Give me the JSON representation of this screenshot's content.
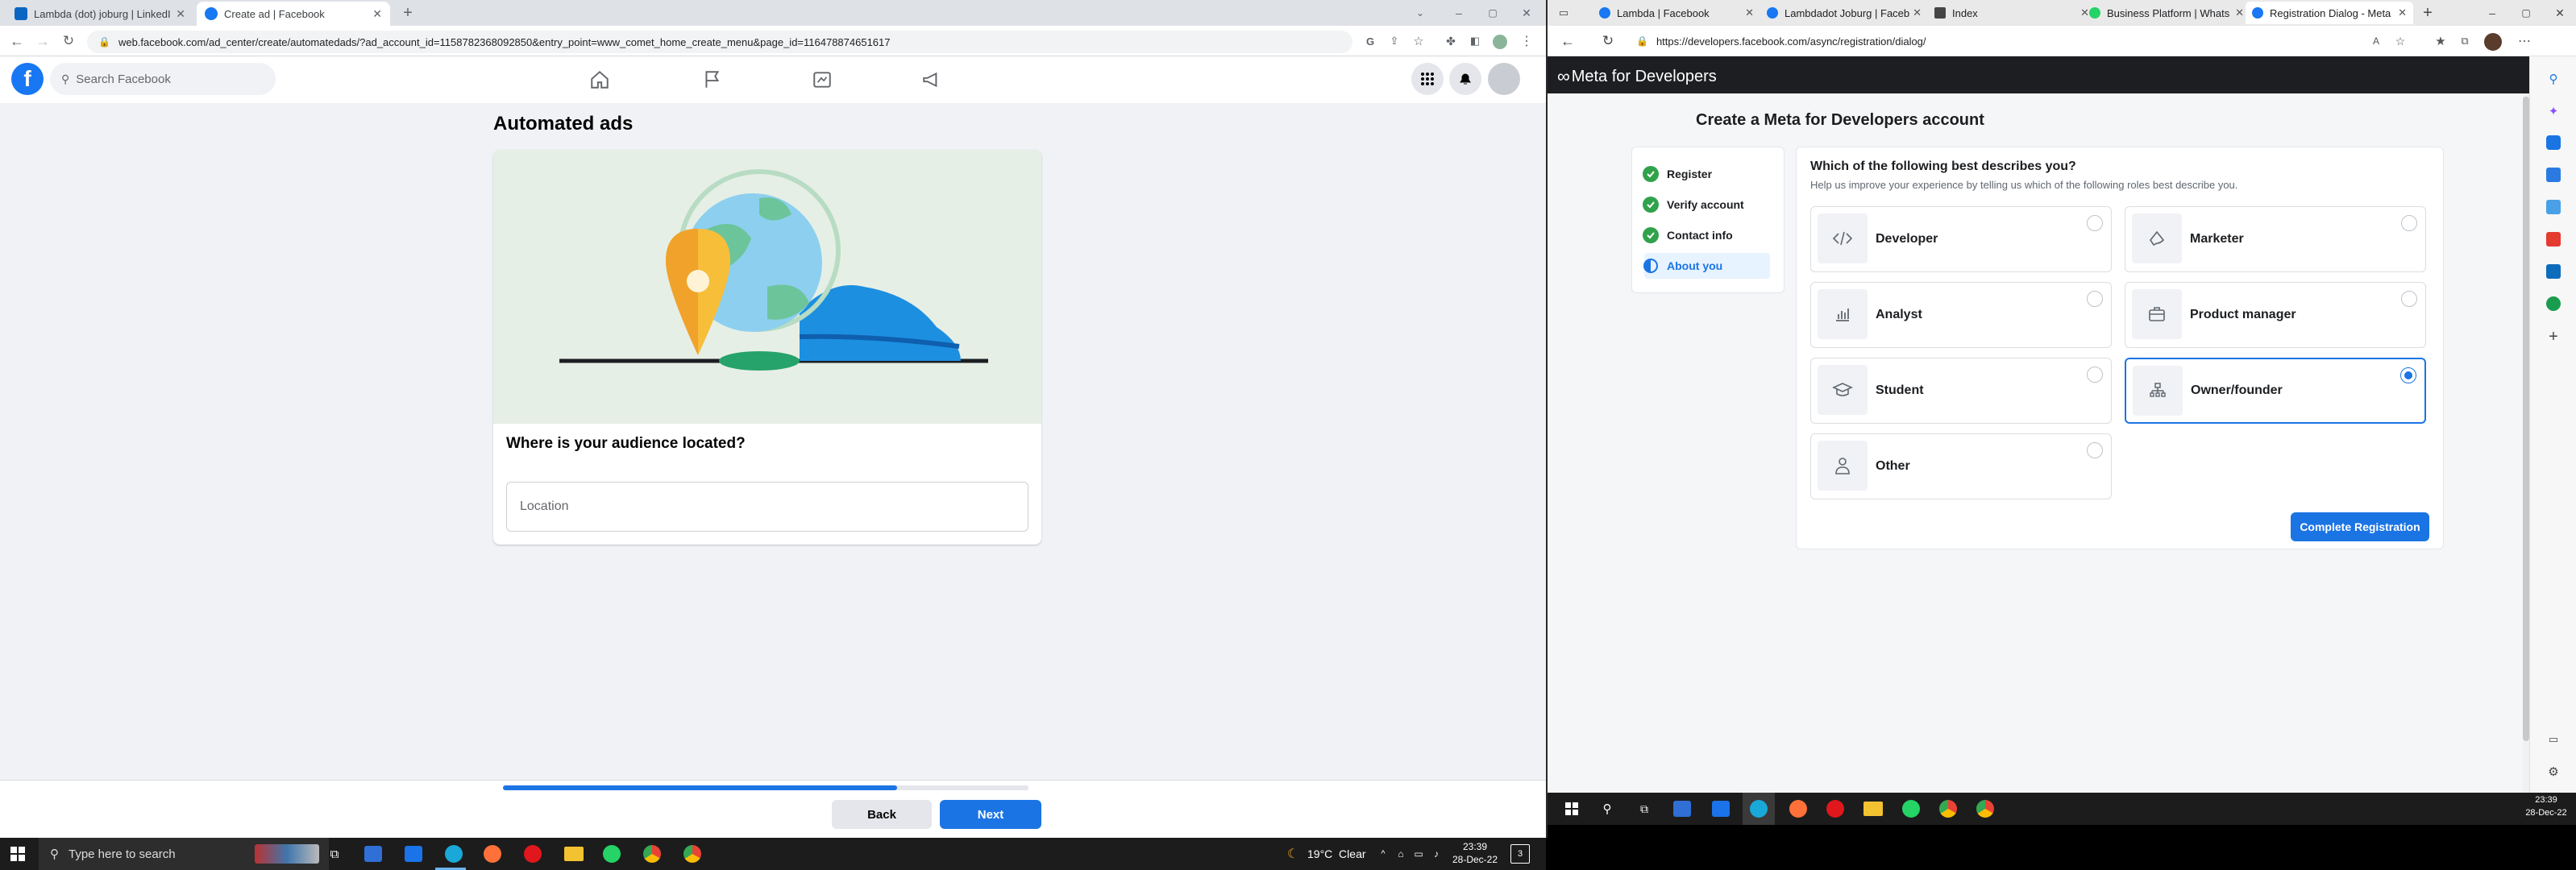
{
  "left_browser": {
    "tabs": [
      {
        "title": "Lambda (dot) joburg | LinkedIn"
      },
      {
        "title": "Create ad | Facebook"
      }
    ],
    "url": "web.facebook.com/ad_center/create/automatedads/?ad_account_id=1158782368092850&entry_point=www_comet_home_create_menu&page_id=116478874651617",
    "search_placeholder": "Search Facebook",
    "page_title": "Automated ads",
    "question": "Where is your audience located?",
    "location_placeholder": "Location",
    "progress": 0.75,
    "back_label": "Back",
    "next_label": "Next"
  },
  "left_taskbar": {
    "search_placeholder": "Type here to search",
    "weather": "19°C  Clear",
    "time": "23:39",
    "date": "28-Dec-22",
    "notification_count": "3"
  },
  "right_browser": {
    "tabs": [
      {
        "title": "Lambda | Facebook"
      },
      {
        "title": "Lambdadot Joburg | Faceb"
      },
      {
        "title": "Index"
      },
      {
        "title": "Business Platform | Whats"
      },
      {
        "title": "Registration Dialog - Meta"
      }
    ],
    "url": "https://developers.facebook.com/async/registration/dialog/",
    "brand": "Meta for Developers",
    "heading": "Create a Meta for Developers account",
    "steps": [
      {
        "label": "Register",
        "state": "done"
      },
      {
        "label": "Verify account",
        "state": "done"
      },
      {
        "label": "Contact info",
        "state": "done"
      },
      {
        "label": "About you",
        "state": "current"
      }
    ],
    "question": "Which of the following best describes you?",
    "subtitle": "Help us improve your experience by telling us which of the following roles best describe you.",
    "roles": [
      {
        "label": "Developer",
        "icon": "code-icon",
        "selected": false
      },
      {
        "label": "Marketer",
        "icon": "megaphone-icon",
        "selected": false
      },
      {
        "label": "Analyst",
        "icon": "bar-chart-icon",
        "selected": false
      },
      {
        "label": "Product manager",
        "icon": "briefcase-icon",
        "selected": false
      },
      {
        "label": "Student",
        "icon": "graduation-cap-icon",
        "selected": false
      },
      {
        "label": "Owner/founder",
        "icon": "org-chart-icon",
        "selected": true
      },
      {
        "label": "Other",
        "icon": "person-icon",
        "selected": false
      }
    ],
    "complete_label": "Complete Registration"
  },
  "right_taskbar": {
    "time": "23:39",
    "date": "28-Dec-22"
  },
  "colors": {
    "facebook_blue": "#1877f2",
    "meta_blue": "#1b74e4",
    "success_green": "#31a24c"
  }
}
